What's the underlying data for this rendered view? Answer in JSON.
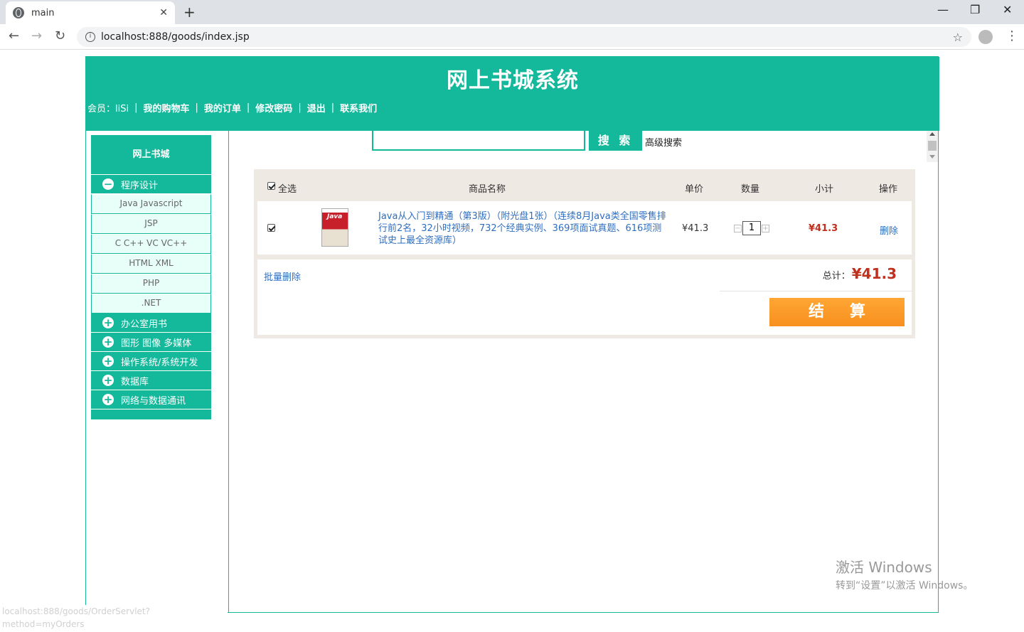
{
  "browser": {
    "tab_title": "main",
    "tab_close": "✕",
    "new_tab": "+",
    "url": "localhost:888/goods/index.jsp",
    "minimize": "—",
    "restore": "❐",
    "close": "✕",
    "back": "←",
    "forward": "→",
    "reload": "↻",
    "star": "☆",
    "menu": "⋮",
    "status_url": "localhost:888/goods/OrderServlet?method=myOrders"
  },
  "header": {
    "title": "网上书城系统",
    "member_label": "会员：liSi",
    "links": [
      "我的购物车",
      "我的订单",
      "修改密码",
      "退出",
      "联系我们"
    ],
    "separator": "|"
  },
  "sidebar": {
    "title": "网上书城",
    "expanded_category": {
      "label": "程序设计",
      "toggle": "−"
    },
    "sub_items": [
      "Java Javascript",
      "JSP",
      "C C++ VC VC++",
      "HTML XML",
      "PHP",
      ".NET"
    ],
    "collapsed_categories": [
      "办公室用书",
      "图形 图像 多媒体",
      "操作系统/系统开发",
      "数据库",
      "网络与数据通讯"
    ],
    "collapsed_toggle": "+"
  },
  "search": {
    "value": "",
    "button": "搜 索",
    "advanced": "高级搜索"
  },
  "cart": {
    "columns": {
      "select_all": "全选",
      "name": "商品名称",
      "price": "单价",
      "qty": "数量",
      "subtotal": "小计",
      "action": "操作"
    },
    "item": {
      "cover_text": "Java",
      "name": "Java从入门到精通（第3版）（附光盘1张）（连续8月Java类全国零售排行前2名，32小时视频，732个经典实例、369项面试真题、616项测试史上最全资源库）",
      "price": "¥41.3",
      "qty": "1",
      "minus": "−",
      "plus": "+",
      "subtotal": "¥41.3",
      "delete": "删除"
    },
    "batch_delete": "批量删除",
    "total_label": "总计：",
    "total": "¥41.3",
    "checkout": "结算"
  },
  "watermark": {
    "line1": "激活 Windows",
    "line2": "转到“设置”以激活 Windows。"
  }
}
